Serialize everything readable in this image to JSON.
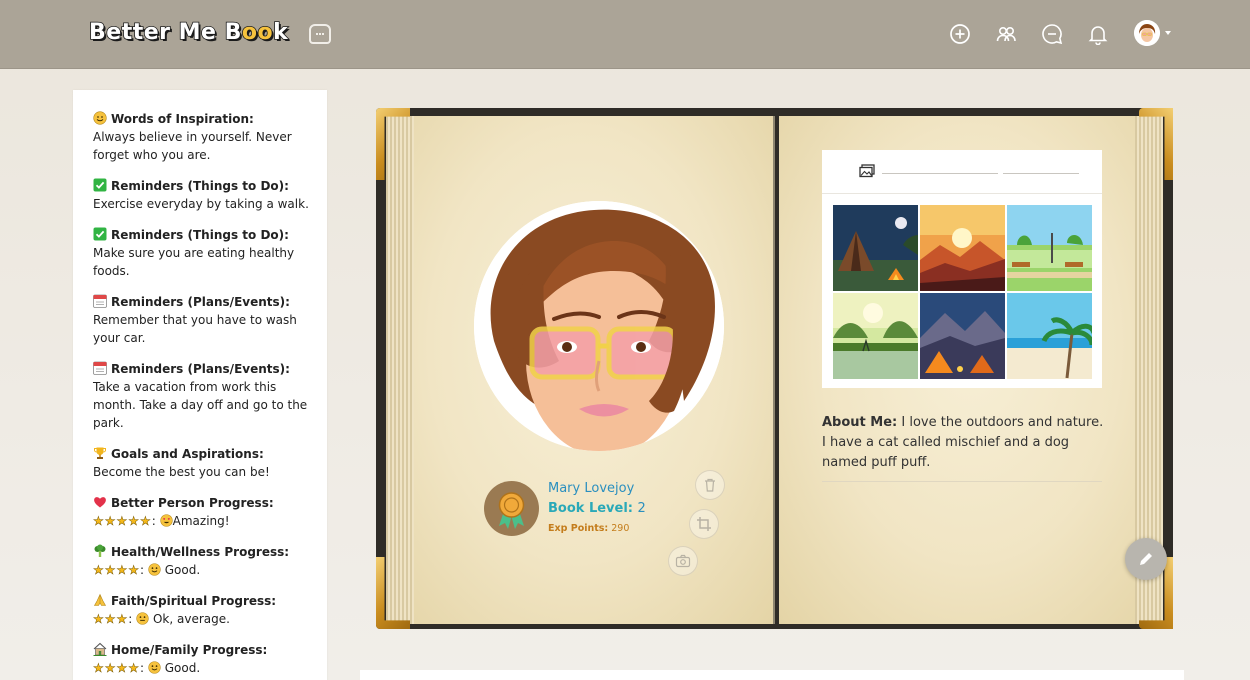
{
  "header": {
    "brand_text_1": "Better Me B",
    "brand_text_oo": "oo",
    "brand_text_2": "k",
    "icons": [
      "home-icon",
      "add-icon",
      "friends-icon",
      "messages-icon",
      "notifications-icon",
      "user-avatar"
    ]
  },
  "sidebar": {
    "notes": [
      {
        "emoji": "smile",
        "title": "Words of Inspiration:",
        "body": "Always believe in yourself. Never forget who you are."
      },
      {
        "emoji": "check",
        "title": "Reminders (Things to Do):",
        "body": "Exercise everyday by taking a walk."
      },
      {
        "emoji": "check",
        "title": "Reminders (Things to Do):",
        "body": "Make sure you are eating healthy foods."
      },
      {
        "emoji": "calendar",
        "title": "Reminders (Plans/Events):",
        "body": "Remember that you have to wash your car."
      },
      {
        "emoji": "calendar",
        "title": "Reminders (Plans/Events):",
        "body": "Take a vacation from work this month. Take a day off and go to the park."
      },
      {
        "emoji": "trophy",
        "title": "Goals and Aspirations:",
        "body": "Become the best you can be!"
      },
      {
        "emoji": "heart",
        "title": "Better Person Progress:",
        "stars": "★★★★★",
        "rating": "Amazing!"
      },
      {
        "emoji": "broccoli",
        "title": "Health/Wellness Progress:",
        "stars": "★★★★",
        "rating": "Good."
      },
      {
        "emoji": "pray",
        "title": "Faith/Spiritual Progress:",
        "stars": "★★★",
        "rating": "Ok, average."
      },
      {
        "emoji": "house",
        "title": "Home/Family Progress:",
        "stars": "★★★★",
        "rating": "Good."
      }
    ]
  },
  "profile": {
    "name": "Mary Lovejoy",
    "book_level_label": "Book Level:",
    "book_level": "2",
    "exp_label": "Exp Points:",
    "exp_points": "290"
  },
  "about": {
    "label": "About Me:",
    "text": "I love the outdoors and nature. I have a cat called mischief and a dog named puff puff."
  },
  "colors": {
    "topbar": "#aba497",
    "name_link": "#2a8fbf",
    "level_label": "#2aa9b8",
    "exp": "#c47d1c"
  }
}
